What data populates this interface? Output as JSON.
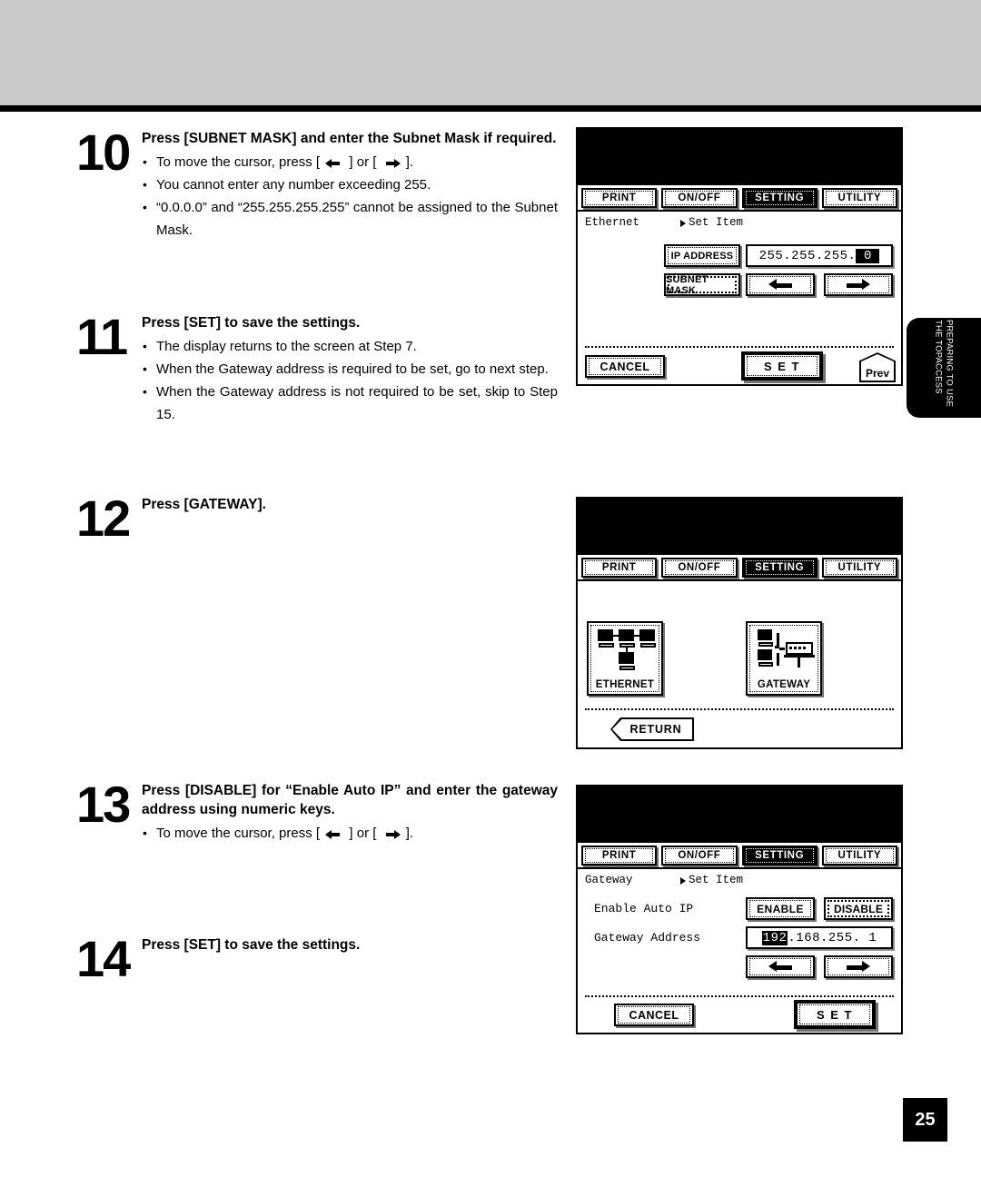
{
  "page": {
    "number": "25",
    "side_tab": "PREPARING TO USE THE TOPACCESS"
  },
  "steps": [
    {
      "number": "10",
      "title": "Press [SUBNET MASK] and enter the Subnet Mask if required.",
      "bullets": [
        {
          "pre": "To move the cursor, press [ ",
          "mid": " ] or [ ",
          "post": " ].",
          "arrows": true
        },
        {
          "text": "You cannot enter any number exceeding 255."
        },
        {
          "text": "“0.0.0.0” and “255.255.255.255” cannot be assigned to the Subnet Mask."
        }
      ]
    },
    {
      "number": "11",
      "title": "Press [SET] to save the settings.",
      "bullets": [
        {
          "text": "The display returns to the screen at Step 7."
        },
        {
          "text": "When the Gateway address is required to be set, go to next step."
        },
        {
          "text": "When the Gateway address is not required to be set, skip to Step 15."
        }
      ]
    },
    {
      "number": "12",
      "title": "Press [GATEWAY].",
      "bullets": []
    },
    {
      "number": "13",
      "title": "Press [DISABLE] for “Enable Auto IP” and enter the gateway address using numeric keys.",
      "bullets": [
        {
          "pre": "To move the cursor, press [ ",
          "mid": " ] or [ ",
          "post": " ].",
          "arrows": true
        }
      ]
    },
    {
      "number": "14",
      "title": "Press [SET] to save the settings.",
      "bullets": []
    }
  ],
  "screens": {
    "tabs": [
      "PRINT",
      "ON/OFF",
      "SETTING",
      "UTILITY"
    ],
    "selected_tab": "SETTING",
    "subnet": {
      "crumb_left": "Ethernet",
      "crumb_right": "Set Item",
      "ip_address_button": "IP ADDRESS",
      "subnet_mask_button": "SUBNET MASK",
      "value_prefix": "255.255.255.",
      "value_cursor": "0",
      "arrow_left": "left-arrow",
      "arrow_right": "right-arrow",
      "cancel_button": "CANCEL",
      "set_button": "S E T",
      "prev_button": "Prev"
    },
    "menu": {
      "ethernet_tile": "ETHERNET",
      "gateway_tile": "GATEWAY",
      "return_button": "RETURN"
    },
    "gateway": {
      "crumb_left": "Gateway",
      "crumb_right": "Set Item",
      "auto_ip_label": "Enable Auto IP",
      "enable_button": "ENABLE",
      "disable_button": "DISABLE",
      "address_label": "Gateway Address",
      "address_cursor": "192",
      "address_rest": ".168.255.  1",
      "cancel_button": "CANCEL",
      "set_button": "S E T"
    }
  }
}
